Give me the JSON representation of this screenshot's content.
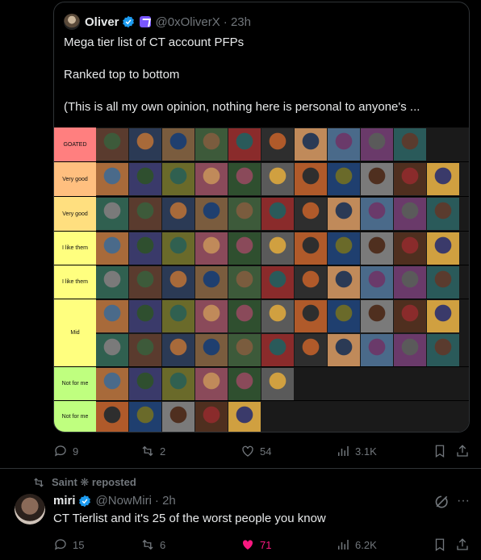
{
  "quoted_tweet": {
    "name": "Oliver",
    "handle": "@0xOliverX",
    "time": "· 23h",
    "lines": [
      "Mega tier list of CT account PFPs",
      "Ranked top to bottom",
      "(This is all my own opinion, nothing here is personal to anyone's ..."
    ],
    "tiers": [
      {
        "label": "GOATED",
        "color": "#ff7f7f",
        "count": 10
      },
      {
        "label": "Very good",
        "color": "#ffbf7f",
        "count": 11
      },
      {
        "label": "Very good",
        "color": "#ffdf7f",
        "count": 11
      },
      {
        "label": "I like them",
        "color": "#ffff7f",
        "count": 11
      },
      {
        "label": "I like them",
        "color": "#ffff7f",
        "count": 11
      },
      {
        "label": "Mid",
        "color": "#ffff7f",
        "count": 22
      },
      {
        "label": "Not for me",
        "color": "#bfff7f",
        "count": 6
      },
      {
        "label": "Not for me",
        "color": "#bfff7f",
        "count": 5
      }
    ],
    "stats": {
      "replies": "9",
      "reposts": "2",
      "likes": "54",
      "views": "3.1K"
    }
  },
  "repost_note": "Saint ❋ reposted",
  "main_tweet": {
    "name": "miri",
    "handle": "@NowMiri",
    "time": "· 2h",
    "text": "CT Tierlist and it's 25 of the worst people you know",
    "stats": {
      "replies": "15",
      "reposts": "6",
      "likes": "71",
      "views": "6.2K"
    }
  },
  "colors": {
    "accent": "#1d9bf0",
    "like": "#f91880",
    "muted": "#71767b"
  }
}
